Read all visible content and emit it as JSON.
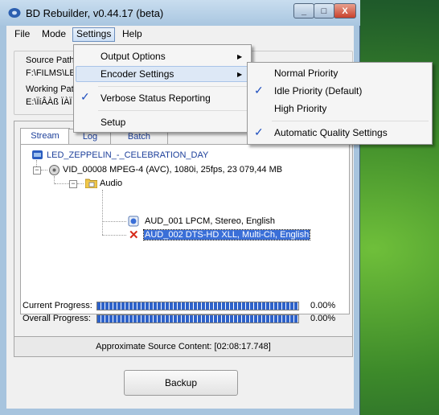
{
  "window": {
    "title": "BD Rebuilder, v0.44.17 (beta)",
    "minimize_glyph": "_",
    "maximize_glyph": "□",
    "close_glyph": "X"
  },
  "menubar": {
    "file": "File",
    "mode": "Mode",
    "settings": "Settings",
    "help": "Help"
  },
  "paths": {
    "source_label": "Source Path",
    "source_value": "F:\\FILMS\\LE",
    "working_label": "Working Pat",
    "working_value": "E:\\ÏíÂÀß ÏÀÏ"
  },
  "tabs": {
    "stream": "Stream",
    "log": "Log",
    "batch": "Batch"
  },
  "tree": {
    "root": "LED_ZEPPELIN_-_CELEBRATION_DAY",
    "video": "VID_00008  MPEG-4 (AVC), 1080i, 25fps, 23 079,44 MB",
    "audio_folder": "Audio",
    "aud1": "AUD_001 LPCM, Stereo, English",
    "aud2": "AUD_002 DTS-HD XLL, Multi-Ch, English",
    "expander_glyph": "−"
  },
  "progress": {
    "current_label": "Current Progress:",
    "current_value": "0.00%",
    "current_fraction": 1.0,
    "overall_label": "Overall Progress:",
    "overall_value": "0.00%",
    "overall_fraction": 1.0
  },
  "status": {
    "text": "Approximate Source Content: [02:08:17.748]"
  },
  "buttons": {
    "backup": "Backup"
  },
  "settings_menu": {
    "output_options": "Output Options",
    "encoder_settings": "Encoder Settings",
    "verbose": "Verbose Status Reporting",
    "setup": "Setup"
  },
  "encoder_submenu": {
    "normal": "Normal Priority",
    "idle": "Idle Priority (Default)",
    "high": "High Priority",
    "auto_quality": "Automatic Quality Settings"
  },
  "icons": {
    "check": "✓",
    "submenu_arrow": "▶",
    "remove": "✕"
  },
  "colors": {
    "accent": "#3a6fd8",
    "titlebar": "#a9c6e0",
    "progress": "#2e62c9"
  }
}
